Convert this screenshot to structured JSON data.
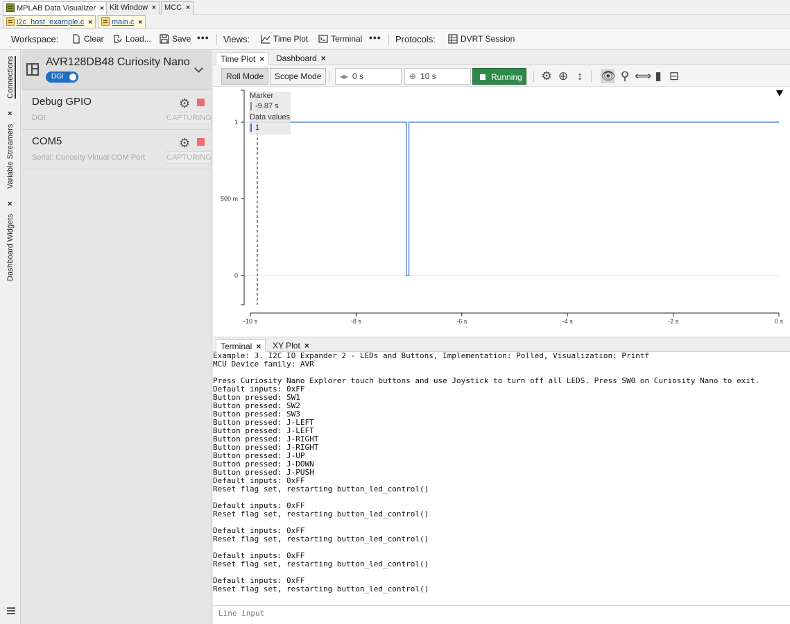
{
  "ide_tabs": [
    {
      "label": "MPLAB Data Visualizer",
      "close": "×"
    },
    {
      "label": "Kit Window",
      "close": "×"
    },
    {
      "label": "MCC",
      "close": "×"
    }
  ],
  "file_tabs": [
    {
      "label": "i2c_host_example.c",
      "close": "×"
    },
    {
      "label": "main.c",
      "close": "×"
    }
  ],
  "toolbar": {
    "workspace_label": "Workspace:",
    "clear": "Clear",
    "load": "Load...",
    "save": "Save",
    "more1": "•••",
    "views_label": "Views:",
    "time_plot": "Time Plot",
    "terminal": "Terminal",
    "more2": "•••",
    "protocols_label": "Protocols:",
    "dvrt_session": "DVRT Session"
  },
  "side_tabs": {
    "connections": "Connections",
    "variable_streamers": "Variable Streamers",
    "dashboard_widgets": "Dashboard Widgets",
    "close": "×"
  },
  "device": {
    "name": "AVR128DB48 Curiosity Nano",
    "toggle_label": "DGI"
  },
  "streams": [
    {
      "name": "Debug GPIO",
      "sub": "DGI",
      "status": "CAPTURING"
    },
    {
      "name": "COM5",
      "sub": "Serial: Curiosity Virtual COM Port",
      "status": "CAPTURING"
    }
  ],
  "plot_tabs": [
    {
      "label": "Time Plot",
      "close": "×"
    },
    {
      "label": "Dashboard",
      "close": "×"
    }
  ],
  "plot_toolbar": {
    "roll_mode": "Roll Mode",
    "scope_mode": "Scope Mode",
    "offset": "0 s",
    "span": "10 s",
    "running": "Running"
  },
  "marker": {
    "label": "Marker",
    "time": "-9.87 s",
    "data_label": "Data values",
    "data_value": "1"
  },
  "chart_data": {
    "type": "line",
    "x": [
      -10,
      -7.05,
      -7.05,
      -7.0,
      -7.0,
      0
    ],
    "series": [
      {
        "values": [
          1,
          1,
          0,
          0,
          1,
          1
        ],
        "color": "#3a6fd8"
      }
    ],
    "xlim": [
      -10,
      0
    ],
    "ylim": [
      -0.2,
      1.2
    ],
    "x_ticks": [
      "-10 s",
      "-8 s",
      "-6 s",
      "-4 s",
      "-2 s",
      "0 s"
    ],
    "y_ticks": [
      "1",
      "500 m",
      "0"
    ],
    "marker_x": -9.87,
    "grid": false
  },
  "terminal_tabs": [
    {
      "label": "Terminal",
      "close": "×"
    },
    {
      "label": "XY Plot",
      "close": "×"
    }
  ],
  "terminal_lines": [
    "Example: 3. I2C IO Expander 2 - LEDs and Buttons, Implementation: Polled, Visualization: Printf",
    "MCU Device family: AVR",
    "",
    "Press Curiosity Nano Explorer touch buttons and use Joystick to turn off all LEDS. Press SW0 on Curiosity Nano to exit.",
    "Default inputs: 0xFF",
    "Button pressed: SW1",
    "Button pressed: SW2",
    "Button pressed: SW3",
    "Button pressed: J-LEFT",
    "Button pressed: J-LEFT",
    "Button pressed: J-RIGHT",
    "Button pressed: J-RIGHT",
    "Button pressed: J-UP",
    "Button pressed: J-DOWN",
    "Button pressed: J-PUSH",
    "Default inputs: 0xFF",
    "Reset flag set, restarting button_led_control()",
    "",
    "Default inputs: 0xFF",
    "Reset flag set, restarting button_led_control()",
    "",
    "Default inputs: 0xFF",
    "Reset flag set, restarting button_led_control()",
    "",
    "Default inputs: 0xFF",
    "Reset flag set, restarting button_led_control()",
    "",
    "Default inputs: 0xFF",
    "Reset flag set, restarting button_led_control()"
  ],
  "line_input_placeholder": "Line input"
}
